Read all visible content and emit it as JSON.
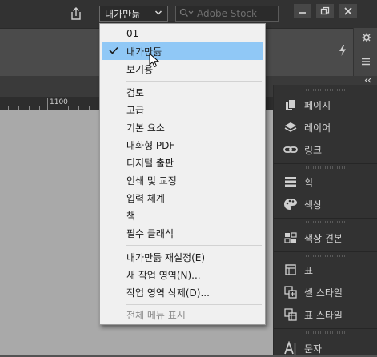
{
  "topbar": {
    "workspace_label": "내가만듦",
    "stock_placeholder": "Adobe Stock"
  },
  "ruler": {
    "label": "1100"
  },
  "menu": {
    "items": [
      {
        "label": "01"
      },
      {
        "label": "내가만듦",
        "checked": true,
        "selected": true
      },
      {
        "label": "보기용"
      },
      {
        "label": "검토"
      },
      {
        "label": "고급"
      },
      {
        "label": "기본 요소"
      },
      {
        "label": "대화형 PDF"
      },
      {
        "label": "디지털 출판"
      },
      {
        "label": "인쇄 및 교정"
      },
      {
        "label": "입력 체계"
      },
      {
        "label": "책"
      },
      {
        "label": "필수 클래식"
      },
      {
        "label": "내가만듦 재설정(E)"
      },
      {
        "label": "새 작업 영역(N)..."
      },
      {
        "label": "작업 영역 삭제(D)..."
      },
      {
        "label": "전체 메뉴 표시",
        "disabled": true
      }
    ]
  },
  "panels": [
    {
      "label": "페이지",
      "icon": "pages-icon"
    },
    {
      "label": "레이어",
      "icon": "layers-icon"
    },
    {
      "label": "링크",
      "icon": "links-icon"
    },
    {
      "label": "획",
      "icon": "stroke-icon"
    },
    {
      "label": "색상",
      "icon": "color-icon"
    },
    {
      "label": "색상 견본",
      "icon": "swatches-icon"
    },
    {
      "label": "표",
      "icon": "table-icon"
    },
    {
      "label": "셀 스타일",
      "icon": "cell-styles-icon"
    },
    {
      "label": "표 스타일",
      "icon": "table-styles-icon"
    },
    {
      "label": "문자",
      "icon": "character-icon"
    }
  ],
  "colors": {
    "menu_highlight": "#90c8f6",
    "menu_background": "#f0f0f0",
    "panel_background": "#323232",
    "canvas": "#a9a9a9"
  }
}
